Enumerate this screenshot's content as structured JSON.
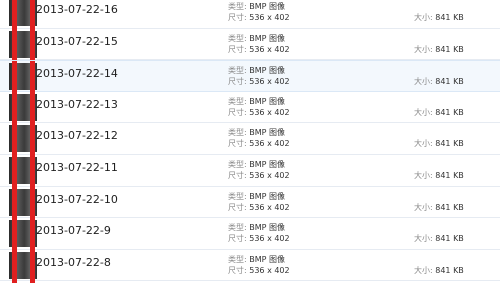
{
  "labels": {
    "type": "类型: ",
    "dims": "尺寸: ",
    "size": "大小: "
  },
  "files": [
    {
      "name": "2013-07-22-16",
      "type": "BMP 图像",
      "dims": "536 x 402",
      "size": "841 KB"
    },
    {
      "name": "2013-07-22-15",
      "type": "BMP 图像",
      "dims": "536 x 402",
      "size": "841 KB"
    },
    {
      "name": "2013-07-22-14",
      "type": "BMP 图像",
      "dims": "536 x 402",
      "size": "841 KB"
    },
    {
      "name": "2013-07-22-13",
      "type": "BMP 图像",
      "dims": "536 x 402",
      "size": "841 KB"
    },
    {
      "name": "2013-07-22-12",
      "type": "BMP 图像",
      "dims": "536 x 402",
      "size": "841 KB"
    },
    {
      "name": "2013-07-22-11",
      "type": "BMP 图像",
      "dims": "536 x 402",
      "size": "841 KB"
    },
    {
      "name": "2013-07-22-10",
      "type": "BMP 图像",
      "dims": "536 x 402",
      "size": "841 KB"
    },
    {
      "name": "2013-07-22-9",
      "type": "BMP 图像",
      "dims": "536 x 402",
      "size": "841 KB"
    },
    {
      "name": "2013-07-22-8",
      "type": "BMP 图像",
      "dims": "536 x 402",
      "size": "841 KB"
    }
  ],
  "selected_index": 2,
  "icons": {
    "file_thumbnail": "bmp-thumbnail-icon"
  },
  "colors": {
    "selection": "#f3f8fd",
    "thumbnail_stripes": "#e02020",
    "label_gray": "#8a8a8a"
  }
}
